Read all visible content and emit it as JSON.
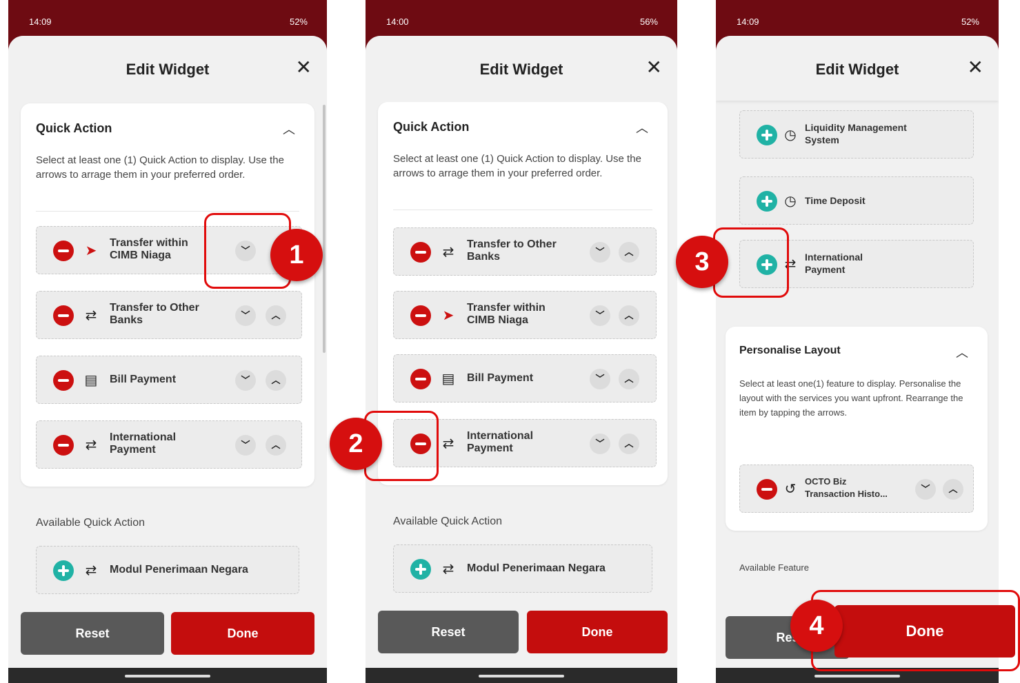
{
  "brand_colors": {
    "red": "#c40d0d",
    "teal": "#20b2a5",
    "header": "#6e0b12"
  },
  "screens": [
    {
      "status_time": "14:09",
      "status_right": "52%",
      "title": "Edit Widget",
      "section_title": "Quick Action",
      "description": "Select at least one (1) Quick Action to display. Use the arrows to arrage them in your preferred order.",
      "selected_items": [
        {
          "line1": "Transfer within",
          "line2": "CIMB Niaga",
          "icon": "chevron-right-icon"
        },
        {
          "line1": "Transfer to Other",
          "line2": "Banks",
          "icon": "transfer-arrows-icon"
        },
        {
          "line1": "Bill Payment",
          "line2": "",
          "icon": "bill-icon"
        },
        {
          "line1": "International",
          "line2": "Payment",
          "icon": "transfer-arrows-icon"
        }
      ],
      "available_title": "Available Quick Action",
      "available_items": [
        {
          "label": "Modul Penerimaan Negara",
          "icon": "transfer-arrows-icon"
        }
      ],
      "reset_label": "Reset",
      "done_label": "Done",
      "step": "1"
    },
    {
      "status_time": "14:00",
      "status_right": "56%",
      "title": "Edit Widget",
      "section_title": "Quick Action",
      "description": "Select at least one (1) Quick Action to display. Use the arrows to arrage them in your preferred order.",
      "selected_items": [
        {
          "line1": "Transfer to Other",
          "line2": "Banks",
          "icon": "transfer-arrows-icon"
        },
        {
          "line1": "Transfer within",
          "line2": "CIMB Niaga",
          "icon": "chevron-right-icon"
        },
        {
          "line1": "Bill Payment",
          "line2": "",
          "icon": "bill-icon"
        },
        {
          "line1": "International",
          "line2": "Payment",
          "icon": "transfer-arrows-icon"
        }
      ],
      "available_title": "Available Quick Action",
      "available_items": [
        {
          "label": "Modul Penerimaan Negara",
          "icon": "transfer-arrows-icon"
        }
      ],
      "reset_label": "Reset",
      "done_label": "Done",
      "step": "2"
    },
    {
      "status_time": "14:09",
      "status_right": "52%",
      "title": "Edit Widget",
      "available_qa_items": [
        {
          "line1": "Liquidity Management",
          "line2": "System",
          "icon": "clock-icon"
        },
        {
          "line1": "Time Deposit",
          "line2": "",
          "icon": "clock-icon"
        },
        {
          "line1": "International",
          "line2": "Payment",
          "icon": "transfer-arrows-icon"
        }
      ],
      "section_title": "Personalise Layout",
      "description": "Select at least one(1) feature to display. Personalise the layout with the services you want upfront. Rearrange the item by tapping the arrows.",
      "layout_items": [
        {
          "line1": "OCTO Biz",
          "line2": "Transaction Histo...",
          "icon": "history-icon"
        }
      ],
      "available_title": "Available Feature",
      "reset_label": "Res",
      "done_label": "Done",
      "step3": "3",
      "step4": "4"
    }
  ]
}
